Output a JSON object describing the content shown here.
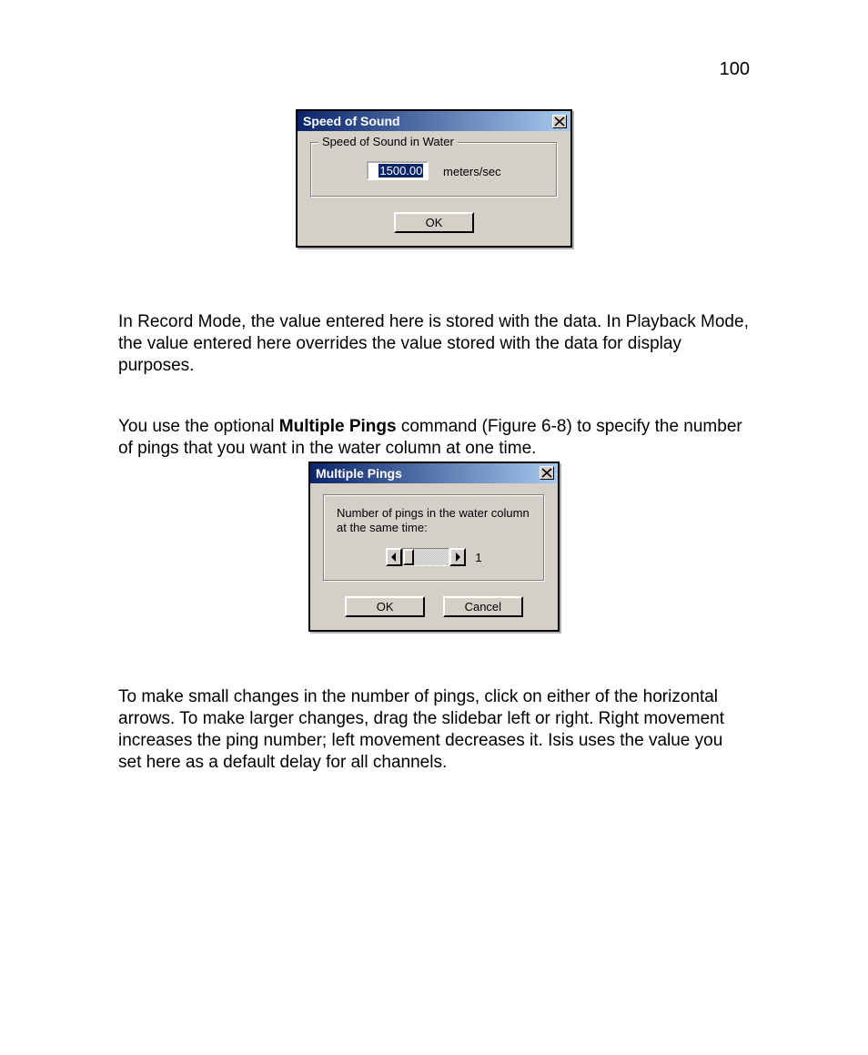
{
  "page_number": "100",
  "dialog1": {
    "title": "Speed of Sound",
    "group_legend": "Speed of Sound in Water",
    "value": "1500.00",
    "unit": "meters/sec",
    "ok": "OK"
  },
  "para1_a": "In Record Mode, the value entered here is stored with the data. In Playback Mode, the value entered here overrides the value stored with the data for display purposes.",
  "para2_pre": "You use the optional ",
  "para2_bold": "Multiple Pings",
  "para2_post": " command (Figure 6-8) to specify the number of pings that you want in the water column at one time.",
  "dialog2": {
    "title": "Multiple Pings",
    "label": "Number of pings in the water column at the same time:",
    "value": "1",
    "ok": "OK",
    "cancel": "Cancel"
  },
  "para3": "To make small changes in the number of pings, click on either of the horizontal arrows. To make larger changes, drag the slidebar left or right. Right movement increases the ping number; left movement decreases it. Isis uses the value you set here as a default delay for all channels."
}
